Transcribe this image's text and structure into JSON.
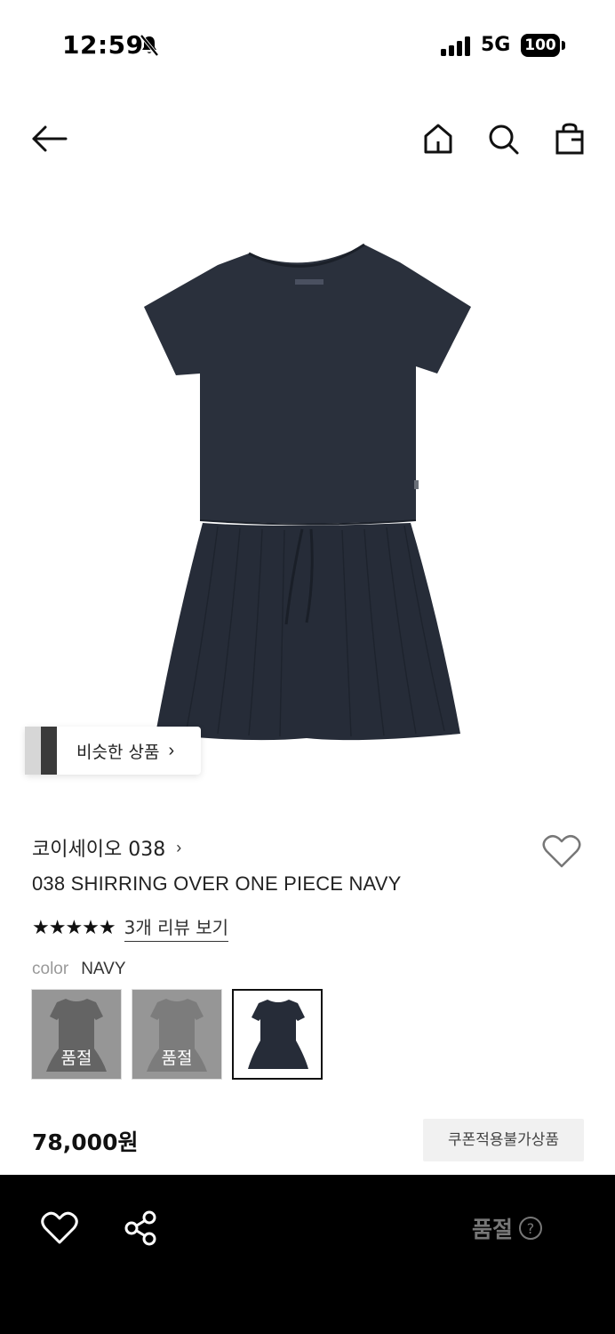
{
  "status_bar": {
    "time": "12:59",
    "network": "5G",
    "battery": "100",
    "icons": [
      "bell-slash-icon",
      "signal-icon",
      "battery-icon"
    ]
  },
  "nav": {
    "icons": [
      "arrow-left-icon",
      "home-icon",
      "search-icon",
      "shopping-bag-icon"
    ]
  },
  "hero": {
    "image": "navy-shirring-dress-photo",
    "similar_label": "비슷한 상품",
    "similar_chevron": "›"
  },
  "product": {
    "brand": "코이세이오 038",
    "brand_chevron": "›",
    "title": "038 SHIRRING OVER ONE PIECE NAVY",
    "stars": "★★★★★",
    "review_link": "3개 리뷰 보기",
    "color_label": "color",
    "color_value": "NAVY",
    "swatches": [
      {
        "soldout": "품절",
        "selected": false
      },
      {
        "soldout": "품절",
        "selected": false
      },
      {
        "soldout": "",
        "selected": true
      }
    ],
    "price": "78,000원",
    "coupon_badge": "쿠폰적용불가상품"
  },
  "bottom_bar": {
    "soldout_label": "품절",
    "icons": [
      "heart-icon",
      "share-icon",
      "question-circle-icon"
    ]
  },
  "colors": {
    "navy": "#262c38",
    "bottom_bar_bg": "#000000",
    "soldout_text": "#777777",
    "coupon_bg": "#f1f1f1"
  }
}
